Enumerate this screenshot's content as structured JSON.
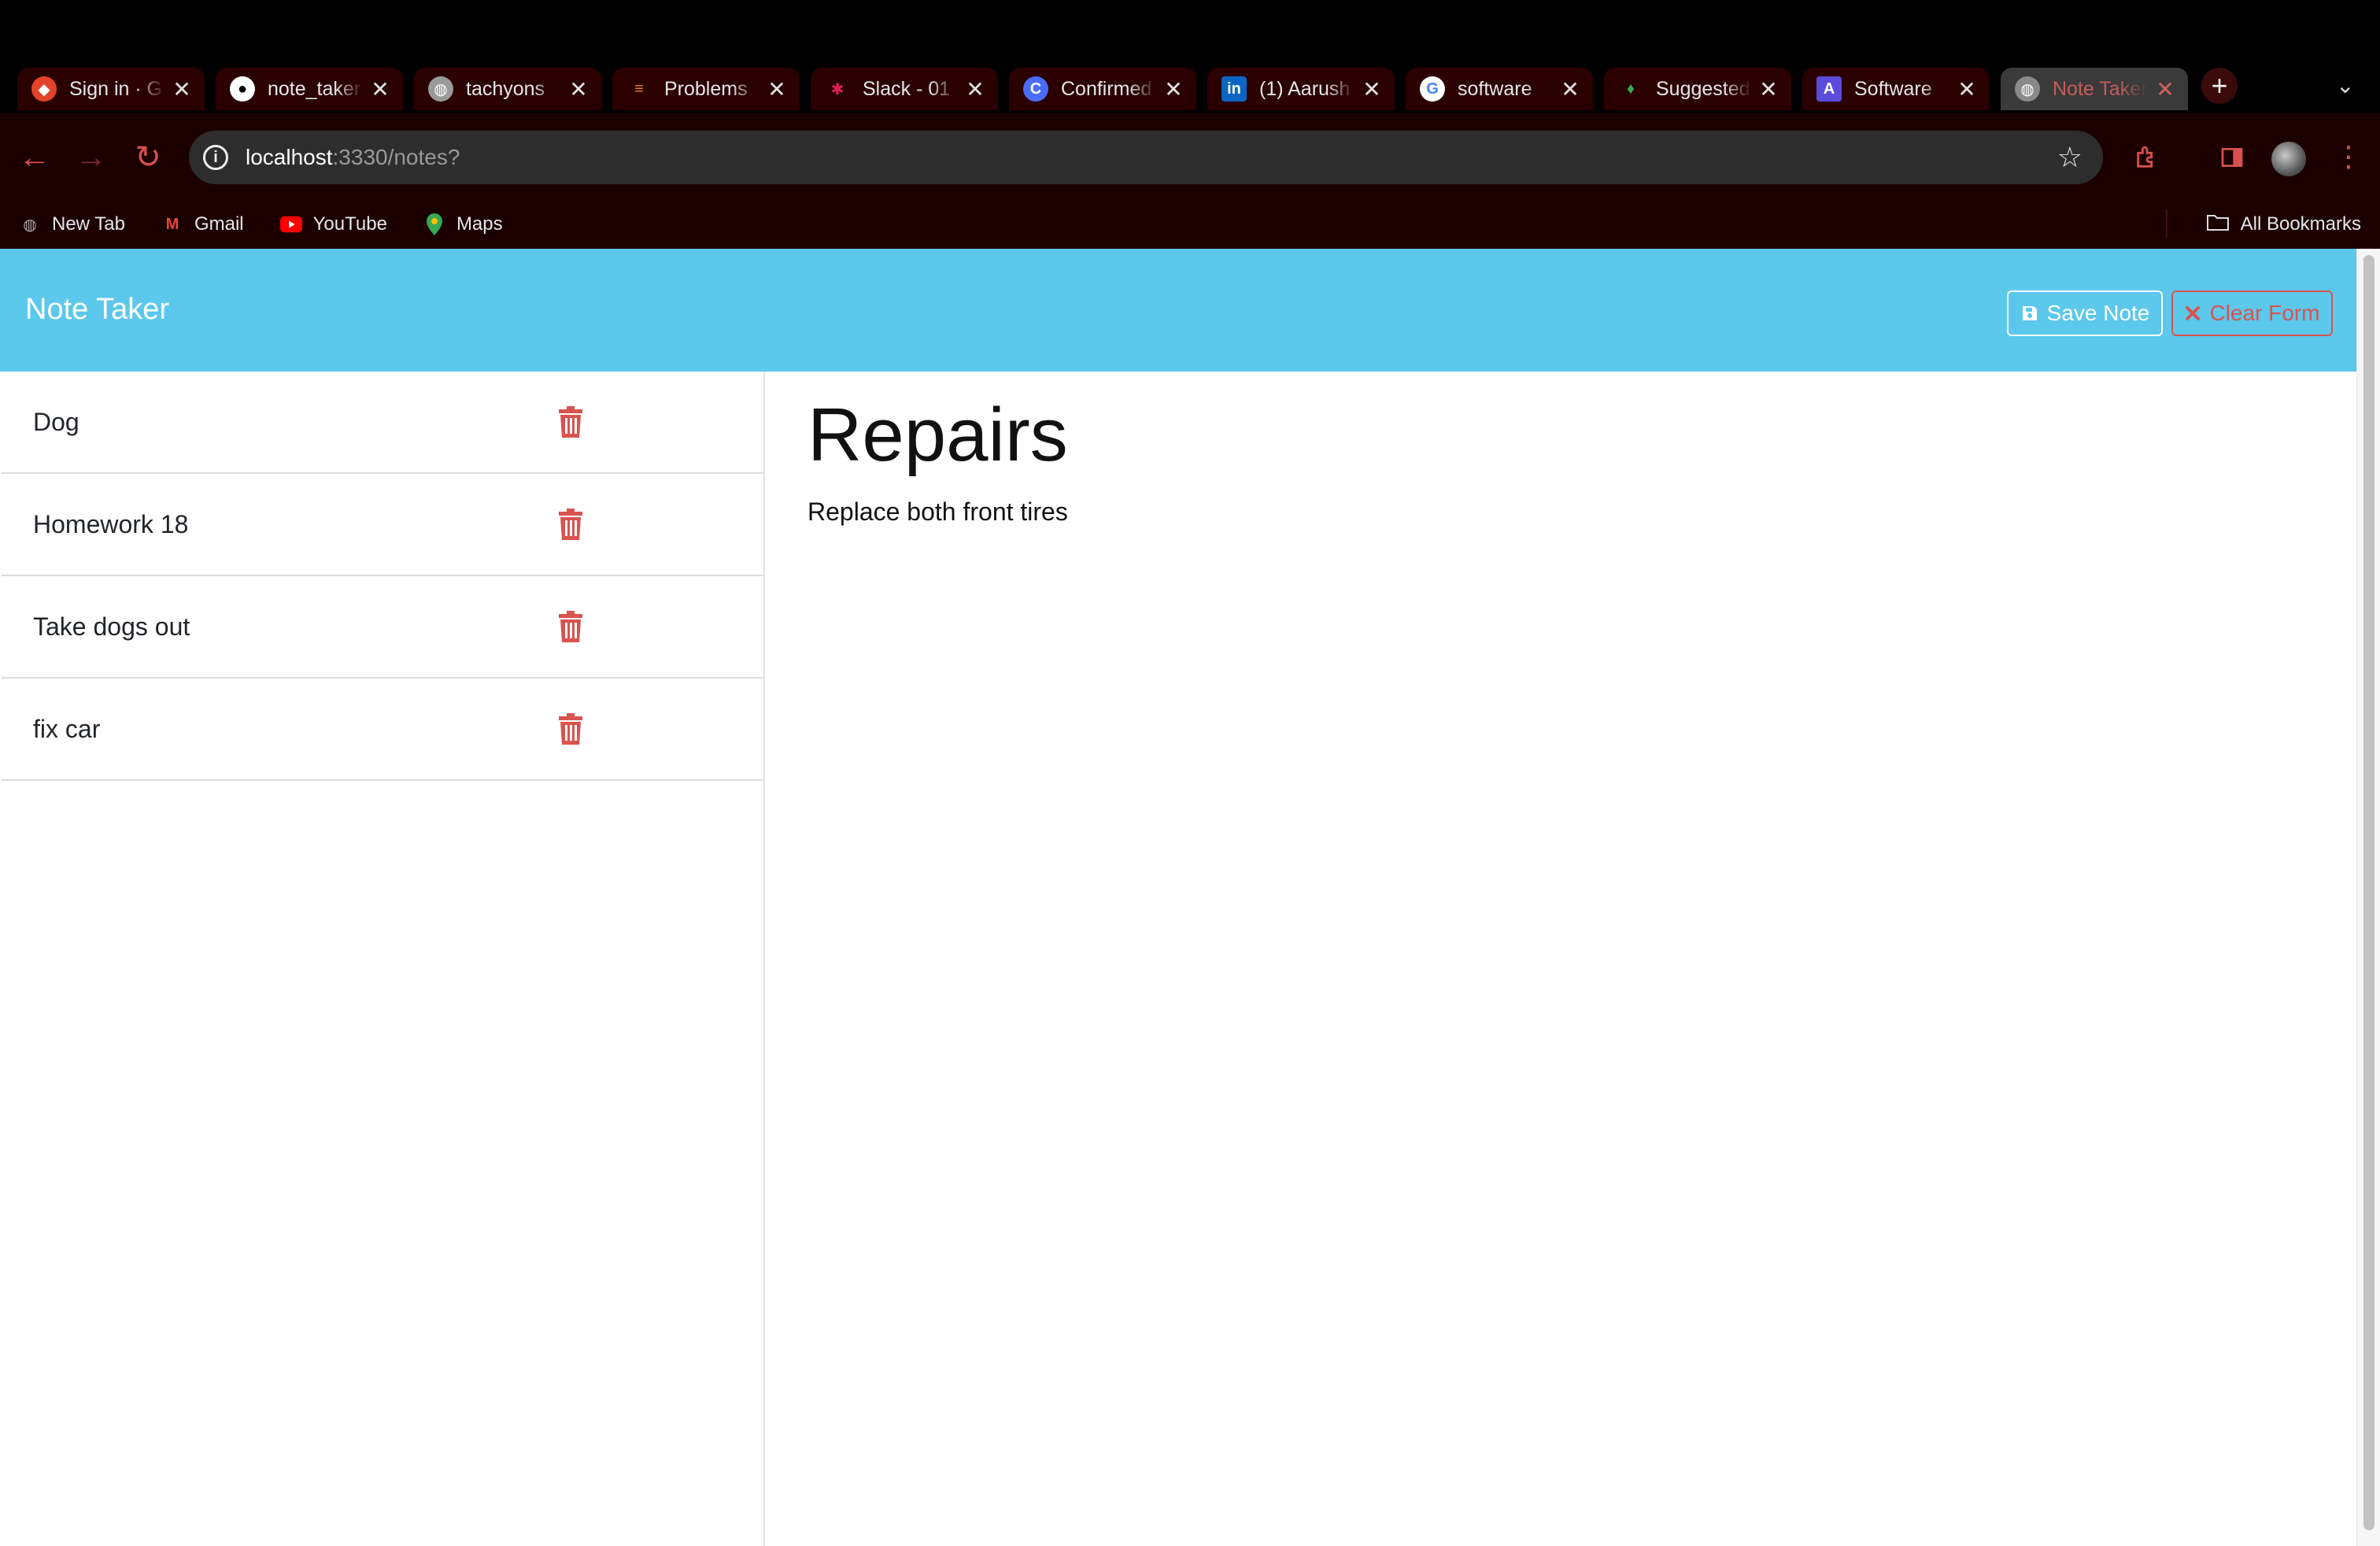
{
  "browser": {
    "tabs": [
      {
        "title": "Sign in · G",
        "icon": "gitlab-icon",
        "color": "#e24329"
      },
      {
        "title": "note_taker",
        "icon": "github-icon",
        "color": "#ffffff"
      },
      {
        "title": "tachyons",
        "icon": "globe-icon",
        "color": "#bbbbbb"
      },
      {
        "title": "Problems",
        "icon": "stackoverflow-icon",
        "color": "#f48024"
      },
      {
        "title": "Slack - 01",
        "icon": "slack-icon",
        "color": "#e01e5a"
      },
      {
        "title": "Confirmed",
        "icon": "confirm-icon",
        "color": "#4a6cf7"
      },
      {
        "title": "(1) Aarush",
        "icon": "linkedin-icon",
        "color": "#0a66c2"
      },
      {
        "title": "software",
        "icon": "google-icon",
        "color": "#4285f4"
      },
      {
        "title": "Suggested",
        "icon": "microphone-icon",
        "color": "#34a853"
      },
      {
        "title": "Software",
        "icon": "a-logo-icon",
        "color": "#5b4bdb"
      },
      {
        "title": "Note Taker",
        "icon": "globe-icon",
        "color": "#bbbbbb",
        "active": true
      }
    ],
    "url_host": "localhost",
    "url_rest": ":3330/notes?",
    "bookmarks": [
      {
        "label": "New Tab",
        "icon": "globe-icon"
      },
      {
        "label": "Gmail",
        "icon": "gmail-icon"
      },
      {
        "label": "YouTube",
        "icon": "youtube-icon"
      },
      {
        "label": "Maps",
        "icon": "maps-icon"
      }
    ],
    "all_bookmarks": "All Bookmarks"
  },
  "app": {
    "brand": "Note Taker",
    "save_label": "Save Note",
    "clear_label": "Clear Form",
    "accent": "#5bc8ec",
    "danger": "#d9534f"
  },
  "notes": [
    {
      "title": "Dog"
    },
    {
      "title": "Homework 18"
    },
    {
      "title": "Take dogs out"
    },
    {
      "title": "fix car"
    }
  ],
  "active_note": {
    "title": "Repairs",
    "text": "Replace both front tires"
  }
}
